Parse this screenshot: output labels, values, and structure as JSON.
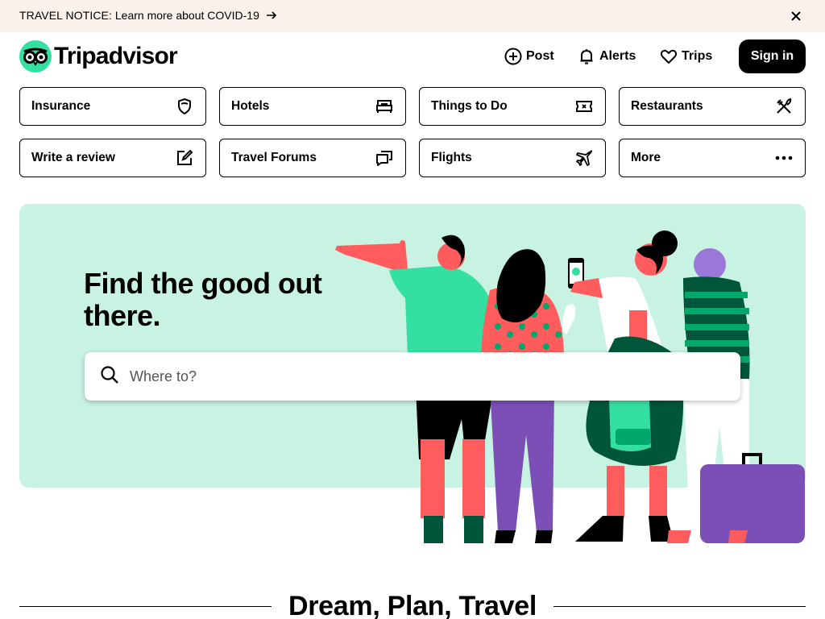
{
  "notice": {
    "label": "TRAVEL NOTICE:",
    "link_text": "Learn more about COVID-19"
  },
  "header": {
    "logo_text": "Tripadvisor",
    "post_label": "Post",
    "alerts_label": "Alerts",
    "trips_label": "Trips",
    "signin_label": "Sign in"
  },
  "categories": [
    {
      "label": "Insurance",
      "icon": "shield-icon"
    },
    {
      "label": "Hotels",
      "icon": "bed-icon"
    },
    {
      "label": "Things to Do",
      "icon": "ticket-icon"
    },
    {
      "label": "Restaurants",
      "icon": "utensils-icon"
    },
    {
      "label": "Write a review",
      "icon": "edit-icon"
    },
    {
      "label": "Travel Forums",
      "icon": "chat-icon"
    },
    {
      "label": "Flights",
      "icon": "plane-icon"
    },
    {
      "label": "More",
      "icon": "more-dots-icon"
    }
  ],
  "hero": {
    "title": "Find the good out there.",
    "search_placeholder": "Where to?",
    "search_value": ""
  },
  "section": {
    "title": "Dream, Plan, Travel"
  },
  "colors": {
    "brand_green": "#34e0a1",
    "hero_bg": "#c8f2e1",
    "notice_bg": "#faf1ed",
    "accent_coral": "#ff5d5d",
    "accent_purple": "#7b4fb5",
    "accent_dark_green": "#00563b"
  }
}
